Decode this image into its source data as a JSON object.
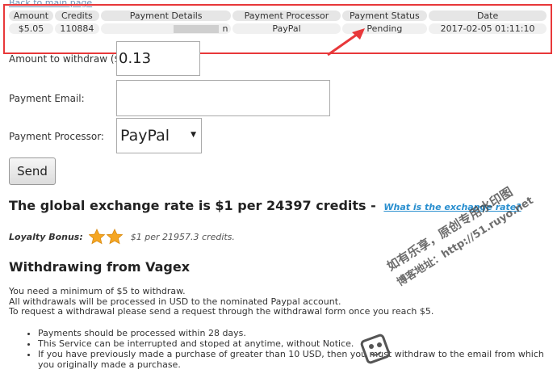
{
  "back_link": "Back to main page",
  "payments": {
    "headers": [
      "Amount",
      "Credits",
      "Payment Details",
      "Payment Processor",
      "Payment Status",
      "Date"
    ],
    "rows": [
      {
        "amount": "$5.05",
        "credits": "110884",
        "details": "n",
        "processor": "PayPal",
        "status": "Pending",
        "date": "2017-02-05 01:11:10"
      }
    ]
  },
  "form": {
    "amount_label": "Amount to withdraw ($):",
    "amount_value": "0.13",
    "email_label": "Payment Email:",
    "email_value": "",
    "processor_label": "Payment Processor:",
    "processor_selected": "PayPal",
    "send_label": "Send"
  },
  "rate": {
    "text": "The global exchange rate is $1 per 24397 credits -",
    "link": "What is the exchange rate?"
  },
  "loyalty": {
    "label": "Loyalty Bonus:",
    "stars": 2,
    "value": "$1 per 21957.3 credits."
  },
  "withdraw": {
    "title": "Withdrawing from Vagex",
    "lines": [
      "You need a minimum of $5 to withdraw.",
      "All withdrawals will be processed in USD to the nominated Paypal account.",
      "To request a withdrawal please send a request through the withdrawal form once you reach $5."
    ],
    "bullets": [
      "Payments should be processed within 28 days.",
      "This Service can be interrupted and stoped at anytime, without Notice.",
      "If you have previously made a purchase of greater than 10 USD, then you must withdraw to the email from which you originally made a purchase."
    ]
  },
  "watermark": {
    "line1": "如有乐享，原创专用水印图",
    "line2": "博客地址：http://51.ruyo.net"
  },
  "colors": {
    "highlight": "#e8383a",
    "link": "#2a8fcf",
    "star": "#f5a623"
  }
}
